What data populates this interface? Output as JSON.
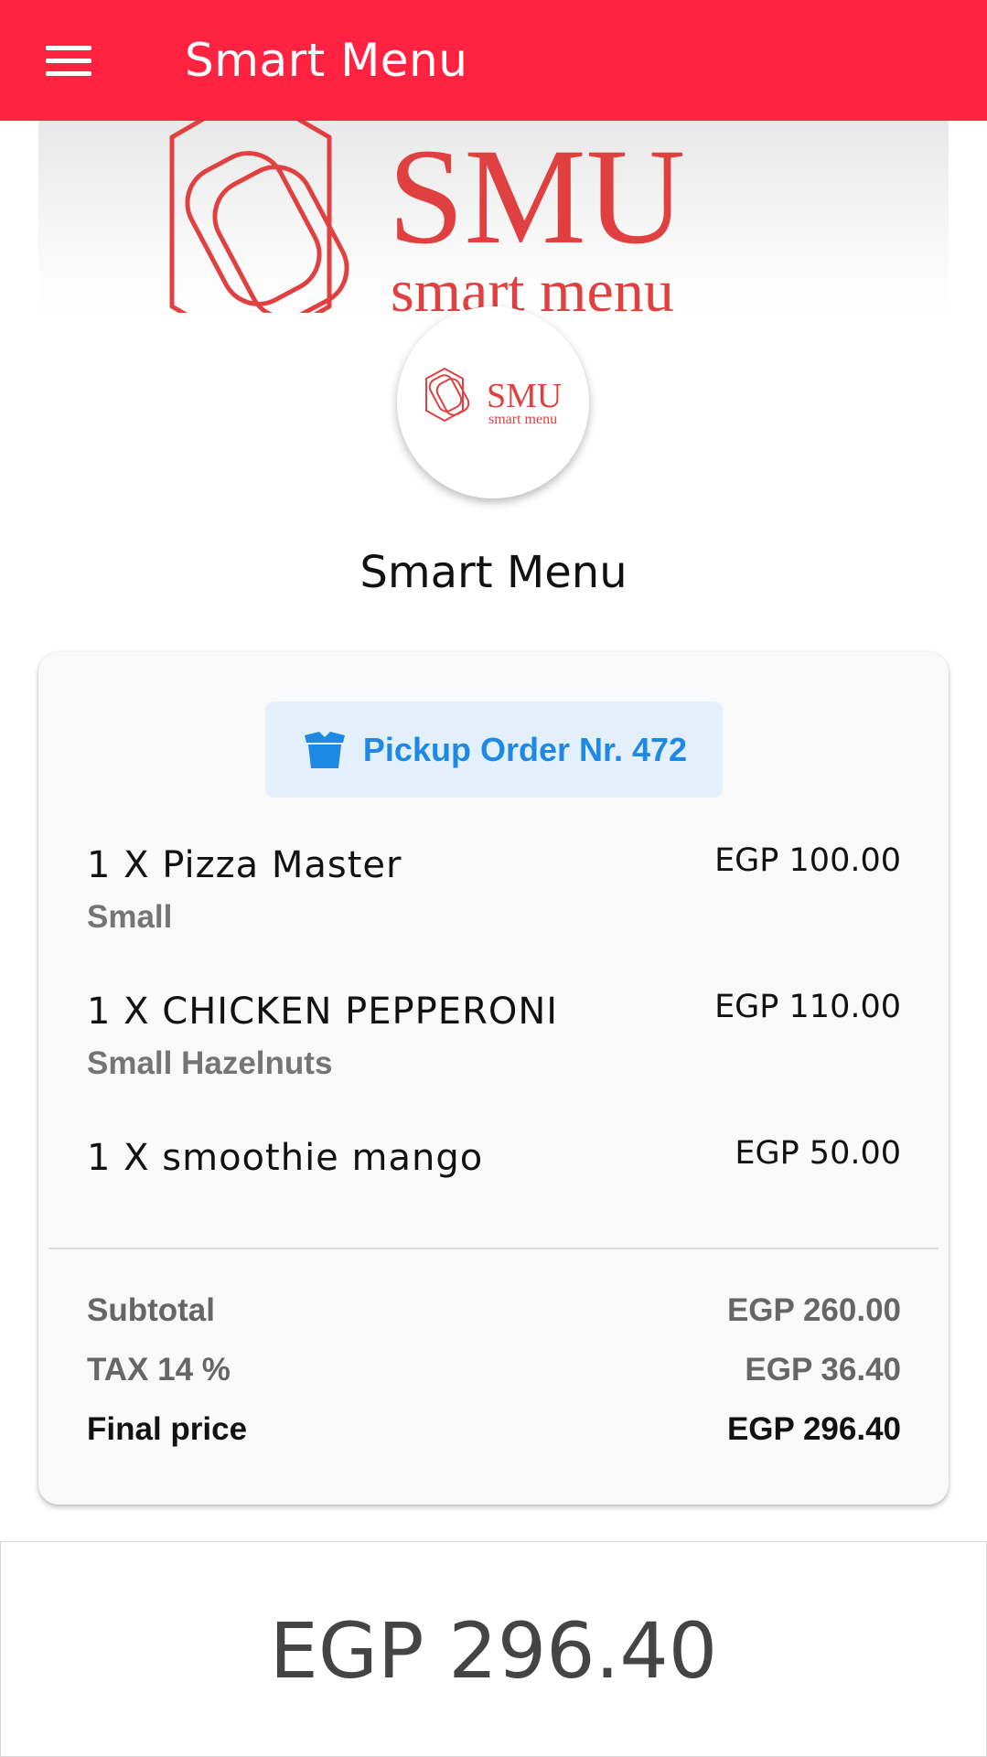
{
  "header": {
    "title": "Smart Menu",
    "menu_icon": "hamburger-menu-icon",
    "background_color": "#ff2341"
  },
  "banner": {
    "logo_text": "SMU",
    "logo_subtext": "smart menu",
    "logo_color": "#e04040"
  },
  "restaurant": {
    "name": "Smart Menu"
  },
  "order": {
    "icon": "box-icon",
    "label": "Pickup Order Nr. 472",
    "accent_color": "#1e88e5",
    "items": [
      {
        "name": "1 X Pizza Master",
        "note": "Small",
        "price": "EGP 100.00"
      },
      {
        "name": "1 X CHICKEN PEPPERONI",
        "note": "Small Hazelnuts",
        "price": "EGP 110.00"
      },
      {
        "name": "1 X smoothie mango",
        "note": "",
        "price": "EGP 50.00"
      }
    ],
    "summary": {
      "subtotal_label": "Subtotal",
      "subtotal_value": "EGP 260.00",
      "tax_label": "TAX 14 %",
      "tax_value": "EGP 36.40",
      "final_label": "Final price",
      "final_value": "EGP 296.40"
    }
  },
  "total": {
    "amount": "EGP 296.40"
  }
}
